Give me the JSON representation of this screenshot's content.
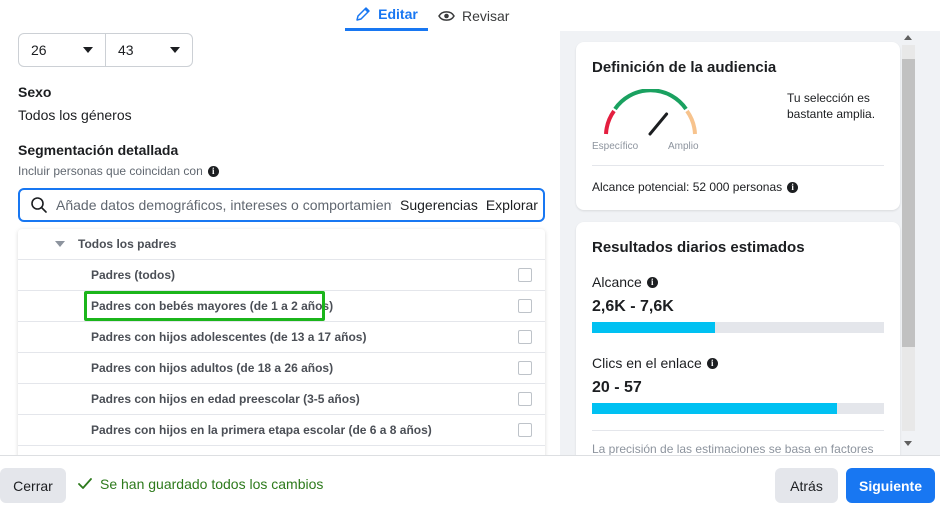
{
  "tabs": {
    "edit": "Editar",
    "review": "Revisar"
  },
  "age": {
    "min": "26",
    "max": "43"
  },
  "gender": {
    "label": "Sexo",
    "value": "Todos los géneros"
  },
  "targeting": {
    "label": "Segmentación detallada",
    "include_label": "Incluir personas que coincidan con",
    "search_placeholder": "Añade datos demográficos, intereses o comportamientos",
    "suggestions": "Sugerencias",
    "explore": "Explorar"
  },
  "list": {
    "header": "Todos los padres",
    "items": [
      "Padres (todos)",
      "Padres con bebés mayores (de 1 a 2 años)",
      "Padres con hijos adolescentes (de 13 a 17 años)",
      "Padres con hijos adultos (de 18 a 26 años)",
      "Padres con hijos en edad preescolar (3-5 años)",
      "Padres con hijos en la primera etapa escolar (de 6 a 8 años)"
    ]
  },
  "audience": {
    "title": "Definición de la audiencia",
    "specific": "Específico",
    "broad": "Amplio",
    "note": "Tu selección es bastante amplia.",
    "reach": "Alcance potencial: 52 000 personas",
    "gauge_level": 0.72
  },
  "results": {
    "title": "Resultados diarios estimados",
    "reach_label": "Alcance",
    "reach_value": "2,6K - 7,6K",
    "reach_fill": 0.42,
    "clicks_label": "Clics en el enlace",
    "clicks_value": "20 - 57",
    "clicks_fill": 0.84,
    "note": "La precisión de las estimaciones se basa en factores"
  },
  "footer": {
    "close": "Cerrar",
    "saved": "Se han guardado todos los cambios",
    "back": "Atrás",
    "next": "Siguiente"
  },
  "colors": {
    "accent": "#1877f2",
    "highlight": "#1bb51b",
    "bar": "#00c1f2",
    "success": "#2d7a1c"
  }
}
